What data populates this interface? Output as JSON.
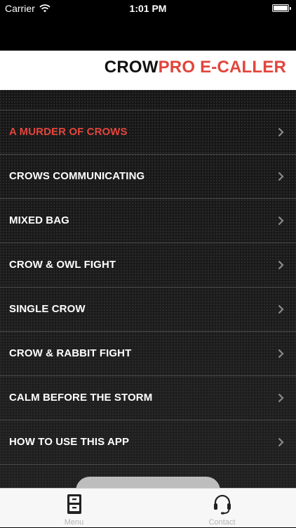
{
  "status_bar": {
    "carrier": "Carrier",
    "time": "1:01 PM",
    "battery_level": 1.0
  },
  "banner": {
    "title_part1": "CROW",
    "title_part2": "PRO E-CALLER"
  },
  "colors": {
    "accent": "#e2453c",
    "text": "#ffffff",
    "tabbar_bg": "#f7f7f7"
  },
  "menu": {
    "items": [
      {
        "label": "A MURDER OF CROWS",
        "active": true
      },
      {
        "label": "CROWS COMMUNICATING"
      },
      {
        "label": "MIXED BAG"
      },
      {
        "label": "CROW & OWL FIGHT"
      },
      {
        "label": "SINGLE CROW"
      },
      {
        "label": "CROW & RABBIT FIGHT"
      },
      {
        "label": "CALM BEFORE THE STORM"
      },
      {
        "label": "HOW TO USE THIS APP"
      }
    ]
  },
  "tabbar": {
    "tabs": [
      {
        "label": "Menu",
        "icon": "file-cabinet-icon"
      },
      {
        "label": "Contact",
        "icon": "headset-icon"
      }
    ]
  }
}
